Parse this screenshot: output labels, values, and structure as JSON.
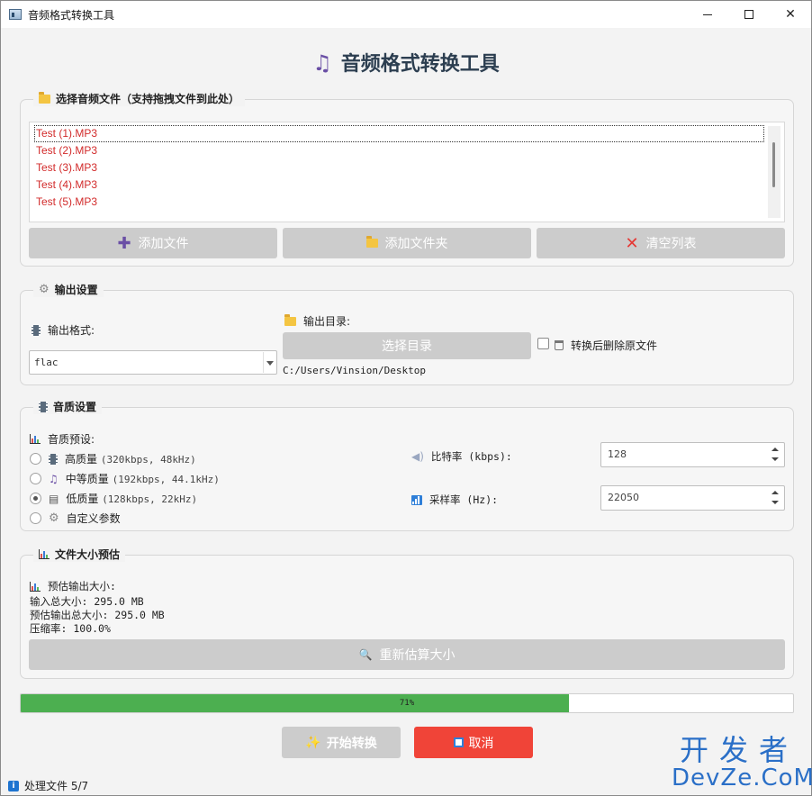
{
  "window": {
    "title": "音频格式转换工具"
  },
  "heading": {
    "icon": "music-note-icon",
    "text": "音频格式转换工具"
  },
  "file_group": {
    "title": "选择音频文件（支持拖拽文件到此处）",
    "files": [
      "Test (1).MP3",
      "Test (2).MP3",
      "Test (3).MP3",
      "Test (4).MP3",
      "Test (5).MP3"
    ],
    "add_files": "添加文件",
    "add_folder": "添加文件夹",
    "clear_list": "清空列表"
  },
  "output_group": {
    "title": "输出设置",
    "format_label": "输出格式:",
    "format_value": "flac",
    "dir_label": "输出目录:",
    "choose_dir": "选择目录",
    "dir_path": "C:/Users/Vinsion/Desktop",
    "delete_original": "转换后删除原文件",
    "delete_checked": false
  },
  "quality_group": {
    "title": "音质设置",
    "preset_label": "音质预设:",
    "presets": [
      {
        "name": "高质量",
        "spec": "(320kbps, 48kHz)",
        "checked": false
      },
      {
        "name": "中等质量",
        "spec": "(192kbps, 44.1kHz)",
        "checked": false
      },
      {
        "name": "低质量",
        "spec": "(128kbps, 22kHz)",
        "checked": true
      },
      {
        "name": "自定义参数",
        "spec": "",
        "checked": false
      }
    ],
    "bitrate_label": "比特率 (kbps):",
    "bitrate_value": "128",
    "samplerate_label": "采样率 (Hz):",
    "samplerate_value": "22050"
  },
  "size_group": {
    "title": "文件大小预估",
    "estimate_title": "预估输出大小:",
    "input_total": "输入总大小: 295.0 MB",
    "output_total": "预估输出总大小: 295.0 MB",
    "compression": "压缩率: 100.0%",
    "recalc": "重新估算大小"
  },
  "progress": {
    "value": 0.71,
    "text": "71%"
  },
  "actions": {
    "start": "开始转换",
    "cancel": "取消"
  },
  "status": {
    "text": "处理文件 5/7"
  },
  "watermark": {
    "line1": "开发者",
    "line2": "DevZe.CoM"
  },
  "colors": {
    "file_text": "#d22b2b",
    "progress_fill": "#4caf50",
    "cancel_bg": "#f04438",
    "accent_purple": "#6a4fa5"
  }
}
